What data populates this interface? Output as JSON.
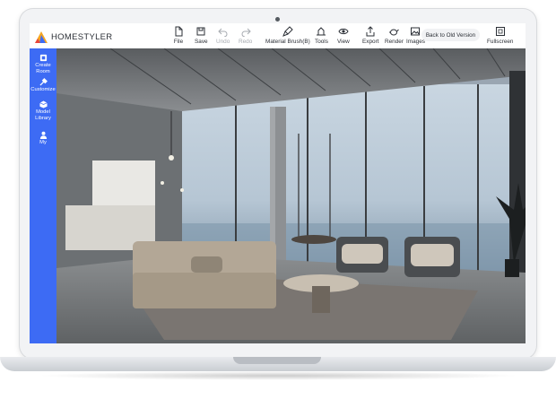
{
  "app": {
    "brand": "HOMESTYLER",
    "accent_color": "#3d6bf4",
    "logo_colors": [
      "#f5a623",
      "#3d6bf4",
      "#e8453c"
    ]
  },
  "toolbar": {
    "file": "File",
    "save": "Save",
    "undo": "Undo",
    "redo": "Redo",
    "material_brush": "Material Brush(B)",
    "tools": "Tools",
    "view": "View",
    "export": "Export",
    "render": "Render",
    "images": "Images",
    "back_to_old": "Back to Old Version",
    "fullscreen": "Fullscreen"
  },
  "sidebar": {
    "items": [
      {
        "label": "Create Room",
        "icon": "create-room-icon"
      },
      {
        "label": "Customize",
        "icon": "customize-icon"
      },
      {
        "label": "Model Library",
        "icon": "cube-icon"
      },
      {
        "label": "My",
        "icon": "user-icon"
      }
    ]
  },
  "viewport": {
    "scene": "interior-living-room-render"
  }
}
